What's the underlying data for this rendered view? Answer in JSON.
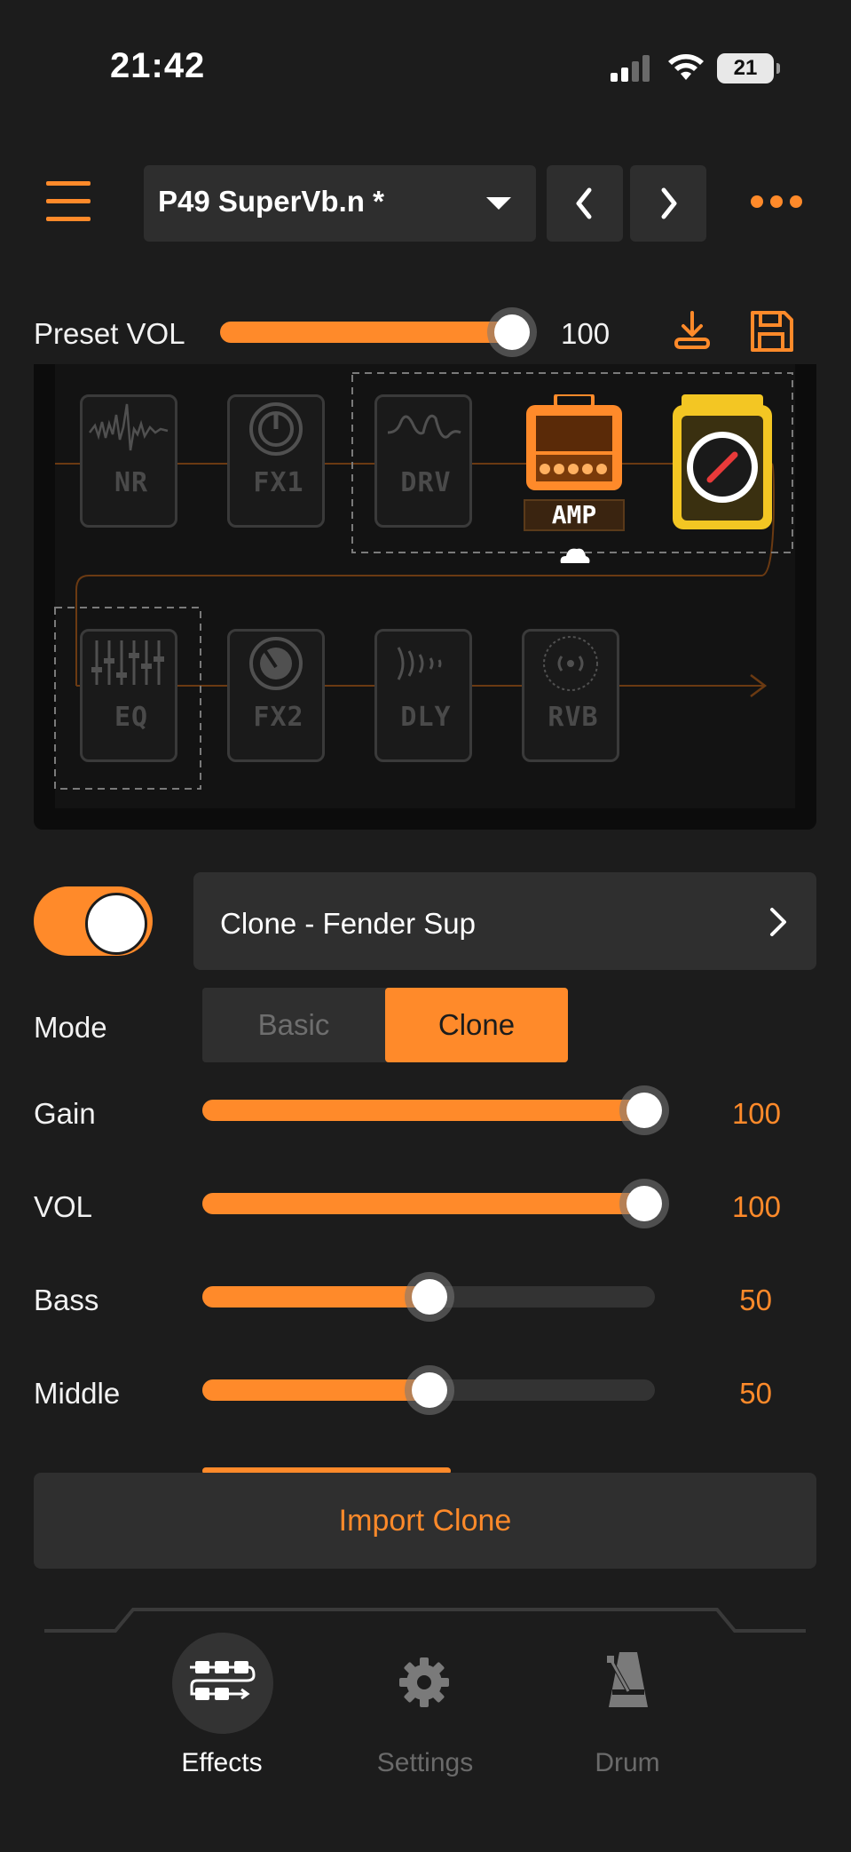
{
  "status": {
    "time": "21:42",
    "battery": "21"
  },
  "header": {
    "preset": "P49  SuperVb.n *"
  },
  "preset_vol": {
    "label": "Preset VOL",
    "value": "100",
    "level": 1.0
  },
  "chain": {
    "row1": [
      "NR",
      "FX1",
      "DRV",
      "AMP",
      ""
    ],
    "row2": [
      "EQ",
      "FX2",
      "DLY",
      "RVB"
    ]
  },
  "amp": {
    "enabled": true,
    "model": "Clone - Fender Sup",
    "mode_label": "Mode",
    "modes": [
      "Basic",
      "Clone"
    ],
    "selected_mode": "Clone",
    "params": [
      {
        "name": "Gain",
        "value": "100",
        "level": 1.0
      },
      {
        "name": "VOL",
        "value": "100",
        "level": 1.0
      },
      {
        "name": "Bass",
        "value": "50",
        "level": 0.5
      },
      {
        "name": "Middle",
        "value": "50",
        "level": 0.5
      }
    ],
    "import_label": "Import Clone"
  },
  "tabs": [
    {
      "label": "Effects",
      "icon": "effects-chain-icon",
      "active": true
    },
    {
      "label": "Settings",
      "icon": "gear-icon",
      "active": false
    },
    {
      "label": "Drum",
      "icon": "metronome-icon",
      "active": false
    }
  ],
  "colors": {
    "accent": "#ff8a2a",
    "background": "#1c1c1c",
    "cab": "#f3c623"
  }
}
